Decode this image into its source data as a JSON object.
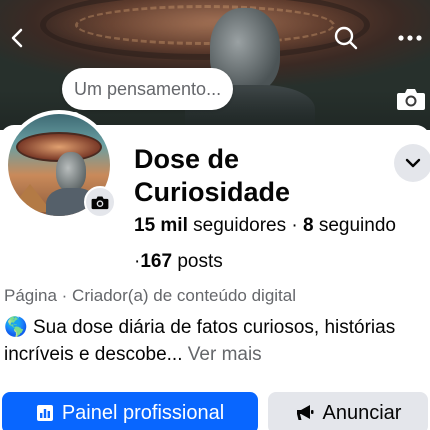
{
  "header": {
    "back_icon": "chevron-left-icon",
    "search_icon": "search-icon",
    "more_icon": "more-horizontal-icon"
  },
  "cover": {
    "camera_icon": "camera-icon",
    "thought_placeholder": "Um pensamento..."
  },
  "profile": {
    "name": "Dose de Curiosidade",
    "followers_count": "15 mil",
    "followers_label": "seguidores",
    "separator": "·",
    "following_count": "8",
    "following_label": "seguindo",
    "posts_prefix": "·",
    "posts_count": "167",
    "posts_label": "posts",
    "category": "Página · Criador(a) de conteúdo digital",
    "bio_emoji": "🌎",
    "bio_text": "Sua dose diária de fatos curiosos, histórias incríveis e descobe...",
    "see_more": "Ver mais"
  },
  "actions": {
    "primary_label": "Painel profissional",
    "primary_icon": "dashboard-icon",
    "secondary_label": "Anunciar",
    "secondary_icon": "megaphone-icon"
  },
  "colors": {
    "accent": "#0866ff",
    "secondary_bg": "#e4e6eb",
    "muted_text": "#65676b"
  }
}
